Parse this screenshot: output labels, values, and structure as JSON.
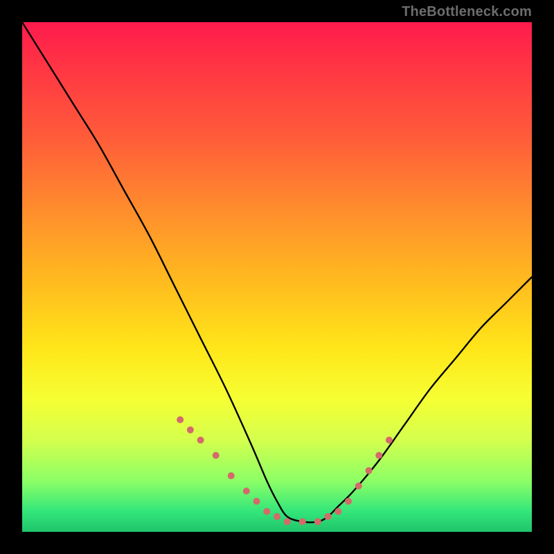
{
  "attribution": "TheBottleneck.com",
  "colors": {
    "background": "#000000",
    "gradient_top": "#ff1a4d",
    "gradient_bottom": "#1fc46b",
    "curve": "#000000",
    "markers": "#d46a6a",
    "attribution_text": "#6d6d6d"
  },
  "chart_data": {
    "type": "line",
    "title": "",
    "xlabel": "",
    "ylabel": "",
    "xlim": [
      0,
      100
    ],
    "ylim": [
      0,
      100
    ],
    "grid": false,
    "legend": false,
    "series": [
      {
        "name": "curve",
        "x": [
          0,
          5,
          10,
          15,
          20,
          25,
          30,
          35,
          40,
          45,
          48,
          50,
          52,
          55,
          58,
          60,
          62,
          65,
          70,
          75,
          80,
          85,
          90,
          95,
          100
        ],
        "y": [
          100,
          92,
          84,
          76,
          67,
          58,
          48,
          38,
          28,
          17,
          10,
          6,
          3,
          2,
          2,
          3,
          5,
          8,
          14,
          21,
          28,
          34,
          40,
          45,
          50
        ]
      }
    ],
    "markers": [
      {
        "x": 31,
        "y": 22
      },
      {
        "x": 33,
        "y": 20
      },
      {
        "x": 35,
        "y": 18
      },
      {
        "x": 38,
        "y": 15
      },
      {
        "x": 41,
        "y": 11
      },
      {
        "x": 44,
        "y": 8
      },
      {
        "x": 46,
        "y": 6
      },
      {
        "x": 48,
        "y": 4
      },
      {
        "x": 50,
        "y": 3
      },
      {
        "x": 52,
        "y": 2
      },
      {
        "x": 55,
        "y": 2
      },
      {
        "x": 58,
        "y": 2
      },
      {
        "x": 60,
        "y": 3
      },
      {
        "x": 62,
        "y": 4
      },
      {
        "x": 64,
        "y": 6
      },
      {
        "x": 66,
        "y": 9
      },
      {
        "x": 68,
        "y": 12
      },
      {
        "x": 70,
        "y": 15
      },
      {
        "x": 72,
        "y": 18
      }
    ]
  }
}
